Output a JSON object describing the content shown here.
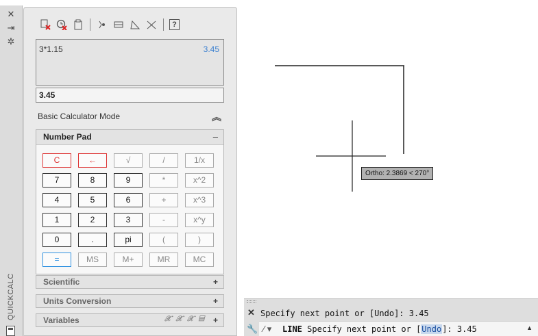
{
  "strip": {
    "label": "QUICKCALC",
    "tools": [
      {
        "icon": "close-icon",
        "glyph": "✕"
      },
      {
        "icon": "autohide-icon",
        "glyph": "⇥"
      },
      {
        "icon": "properties-icon",
        "glyph": "✲"
      }
    ]
  },
  "toolbar": {
    "icons": [
      "clear-icon",
      "clear-history-icon",
      "paste-icon",
      "get-coordinates-icon",
      "distance-icon",
      "angle-icon",
      "intersection-icon",
      "help-icon"
    ],
    "help_label": "?"
  },
  "history": {
    "expression": "3*1.15",
    "result": "3.45"
  },
  "input": {
    "value": "3.45"
  },
  "mode": {
    "label": "Basic Calculator Mode",
    "collapse_glyph": "≈"
  },
  "numpad": {
    "title": "Number Pad",
    "toggle": "–",
    "keys": [
      [
        "C",
        "←",
        "√",
        "/",
        "1/x"
      ],
      [
        "7",
        "8",
        "9",
        "*",
        "x^2"
      ],
      [
        "4",
        "5",
        "6",
        "+",
        "x^3"
      ],
      [
        "1",
        "2",
        "3",
        "-",
        "x^y"
      ],
      [
        "0",
        ".",
        "pi",
        "(",
        ")"
      ],
      [
        "=",
        "MS",
        "M+",
        "MR",
        "MC"
      ]
    ]
  },
  "sections": [
    {
      "label": "Scientific",
      "toggle": "+"
    },
    {
      "label": "Units Conversion",
      "toggle": "+"
    },
    {
      "label": "Variables",
      "toggle": "+",
      "icons": "𝒳 𝒳 𝒳 ▤"
    }
  ],
  "drawing": {
    "tooltip": "Ortho: 2.3869 < 270°"
  },
  "command": {
    "history": "Specify next point or [Undo]: 3.45",
    "command_name": "LINE",
    "prompt_before": " Specify next point or [",
    "prompt_option": "Undo",
    "prompt_after": "]: 3.45",
    "icon_glyph": "⁄ ▾"
  }
}
